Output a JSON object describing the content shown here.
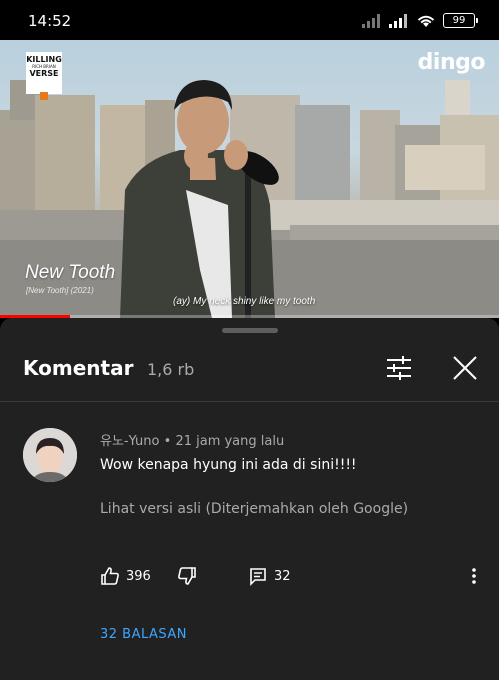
{
  "status_bar": {
    "time": "14:52",
    "battery": "99"
  },
  "video": {
    "show_logo": {
      "line1": "KILLING",
      "line2": "RICH BRIAN",
      "line3": "VERSE"
    },
    "channel_logo": "dingo",
    "song_title": "New Tooth",
    "song_subtitle": "[New Tooth] (2021)",
    "caption": "(ay) My neck shiny like my tooth",
    "progress_fraction": 0.14,
    "progress_color": "#ff0000"
  },
  "comments_panel": {
    "title": "Komentar",
    "count": "1,6 rb",
    "filter_icon": "sort-filter-icon",
    "close_icon": "close-icon"
  },
  "comment": {
    "author": "유노-Yuno",
    "separator": " • ",
    "time": "21 jam yang lalu",
    "text": "Wow kenapa hyung ini ada di sini!!!!",
    "translate_text": "Lihat versi asli (Diterjemahkan oleh Google)",
    "likes": "396",
    "replies_count": "32",
    "replies_link": "32 BALASAN",
    "link_color": "#3ea6ff"
  }
}
